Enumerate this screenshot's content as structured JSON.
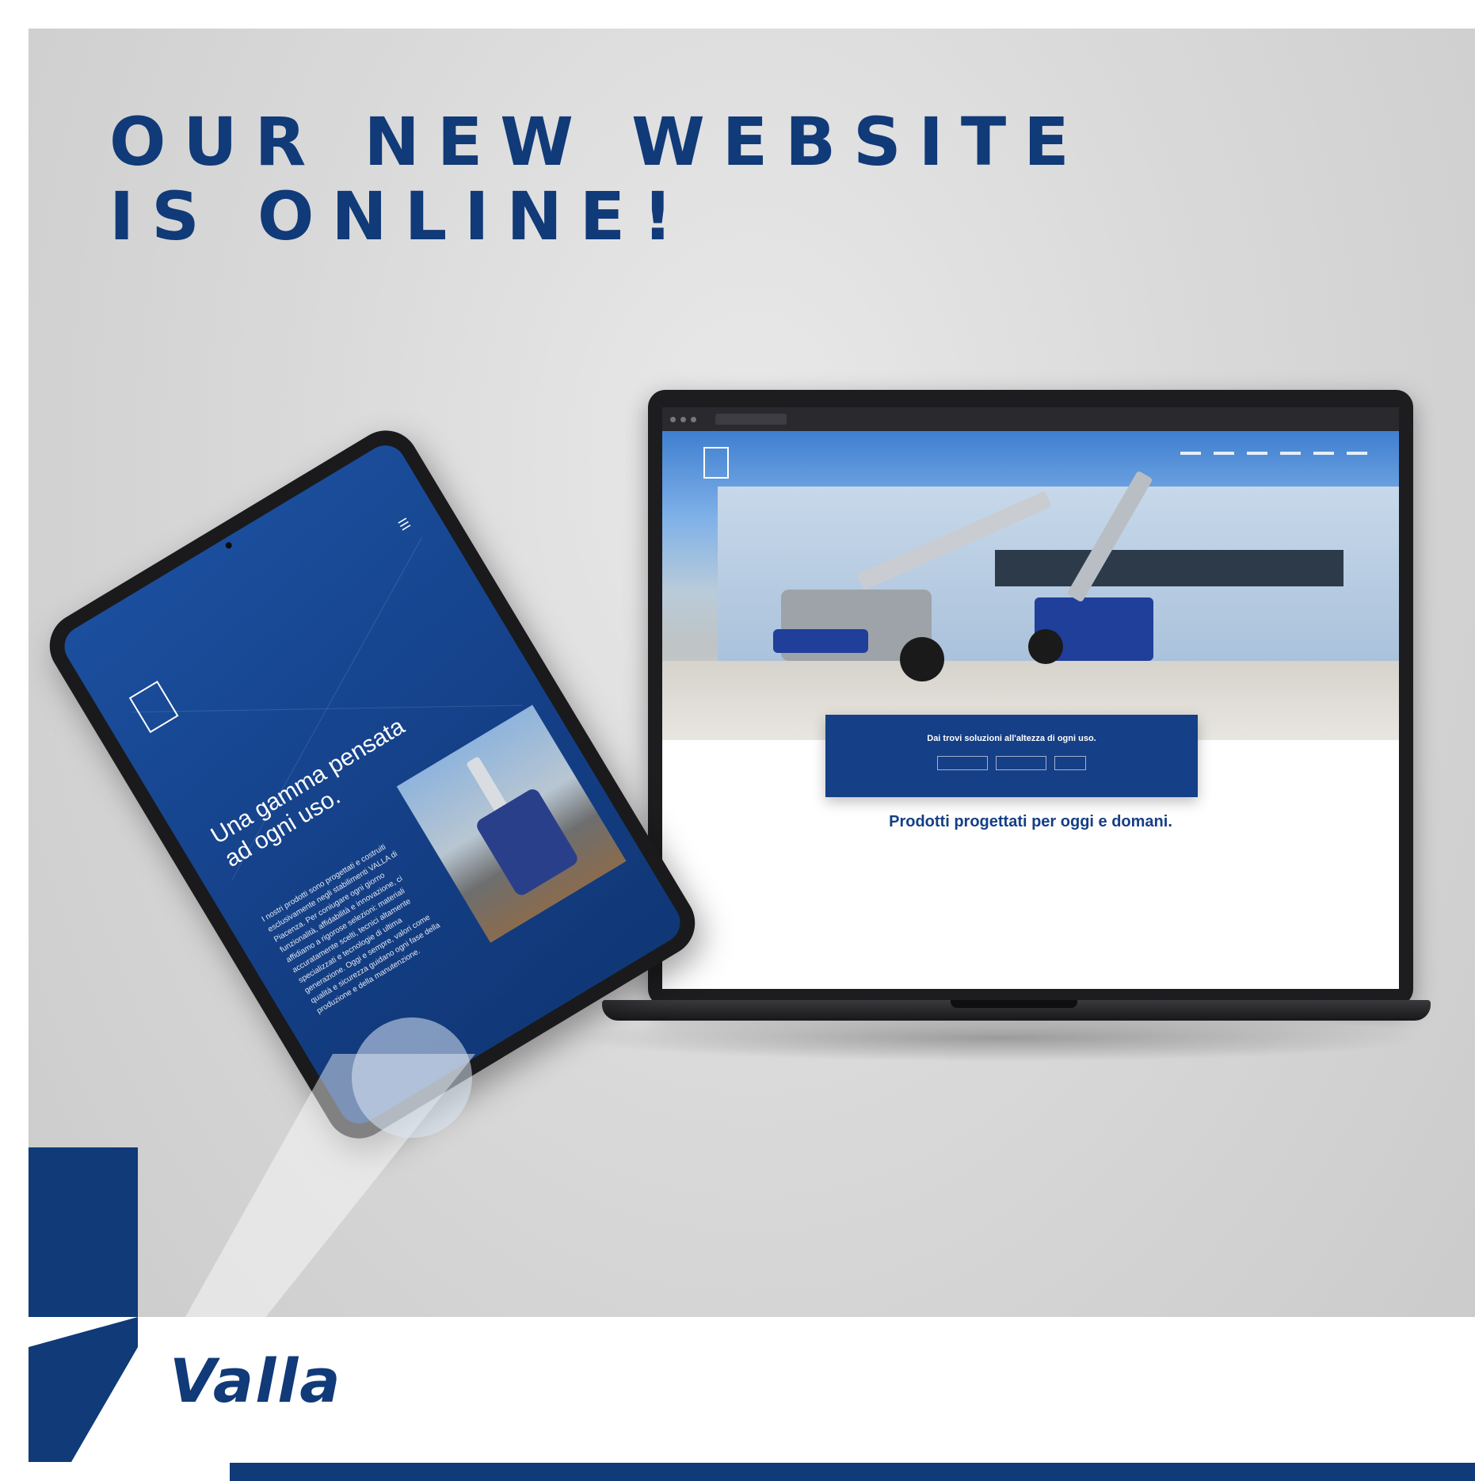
{
  "headline": {
    "line1": "OUR NEW WEBSITE",
    "line2": "IS ONLINE!"
  },
  "tablet": {
    "title": "Una gamma pensata ad ogni uso.",
    "body": "I nostri prodotti sono progettati e costruiti esclusivamente negli stabilimenti VALLA di Piacenza. Per coniugare ogni giorno funzionalità, affidabilità e innovazione, ci affidiamo a rigorose selezioni: materiali accuratamente scelti, tecnici altamente specializzati e tecnologie di ultima generazione. Oggi e sempre, valori come qualità e sicurezza guidano ogni fase della produzione e della manutenzione.",
    "menu_icon": "hamburger-icon"
  },
  "laptop": {
    "cta_text": "Dai trovi soluzioni all'altezza di ogni uso.",
    "subheading": "Prodotti progettati per oggi e domani."
  },
  "brand": {
    "name": "Valla"
  },
  "colors": {
    "brand_blue": "#103a78",
    "screen_blue": "#153f86",
    "background": "#d9d9d9"
  }
}
